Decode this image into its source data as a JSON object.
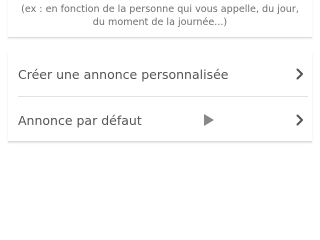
{
  "help": {
    "text": "(ex : en fonction de la personne qui vous appelle, du jour, du moment de la journée...)"
  },
  "menu": {
    "items": [
      {
        "label": "Créer une annonce personnalisée",
        "icon": "chevron-right-icon"
      },
      {
        "label": "Annonce par défaut",
        "icon": "chevron-right-icon",
        "extra_icon": "play-icon"
      }
    ]
  },
  "colors": {
    "text": "#555555",
    "help_text": "#6e6e6e",
    "divider": "#e3e3e3",
    "icon": "#555555",
    "play_icon": "#888888"
  }
}
